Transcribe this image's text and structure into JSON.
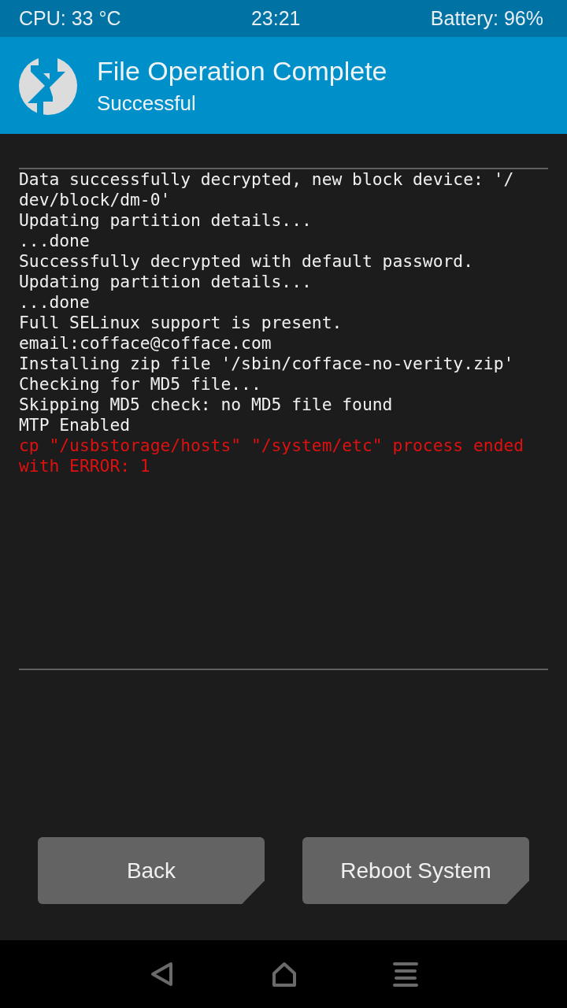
{
  "status_bar": {
    "cpu": "CPU: 33 °C",
    "time": "23:21",
    "battery": "Battery: 96%"
  },
  "header": {
    "title": "File Operation Complete",
    "subtitle": "Successful"
  },
  "log": [
    {
      "kind": "info",
      "text": "Data successfully decrypted, new block device: '/"
    },
    {
      "kind": "info",
      "text": "dev/block/dm-0'"
    },
    {
      "kind": "info",
      "text": "Updating partition details..."
    },
    {
      "kind": "info",
      "text": "...done"
    },
    {
      "kind": "info",
      "text": "Successfully decrypted with default password."
    },
    {
      "kind": "info",
      "text": "Updating partition details..."
    },
    {
      "kind": "info",
      "text": "...done"
    },
    {
      "kind": "info",
      "text": "Full SELinux support is present."
    },
    {
      "kind": "info",
      "text": "email:cofface@cofface.com"
    },
    {
      "kind": "info",
      "text": "Installing zip file '/sbin/cofface-no-verity.zip'"
    },
    {
      "kind": "info",
      "text": "Checking for MD5 file..."
    },
    {
      "kind": "info",
      "text": "Skipping MD5 check: no MD5 file found"
    },
    {
      "kind": "info",
      "text": "MTP Enabled"
    },
    {
      "kind": "error",
      "text": "cp \"/usbstorage/hosts\" \"/system/etc\" process ended"
    },
    {
      "kind": "error",
      "text": "with ERROR: 1"
    }
  ],
  "buttons": [
    "Back",
    "Reboot System"
  ]
}
